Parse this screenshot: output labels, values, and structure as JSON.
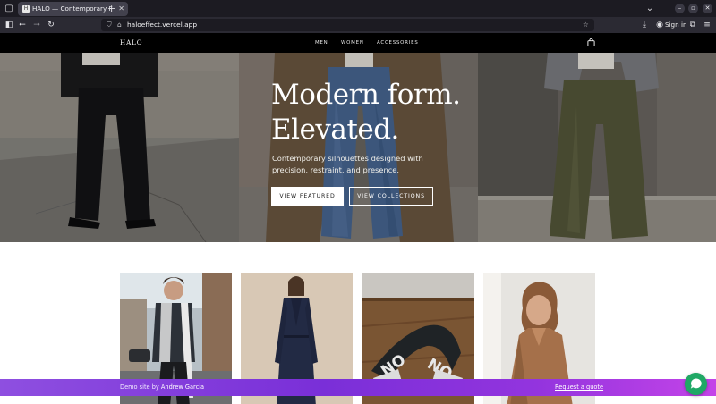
{
  "browser": {
    "tab_title": "HALO — Contemporary F",
    "tab_favicon": "H",
    "url": "haloeffect.vercel.app",
    "sign_in": "Sign in"
  },
  "site": {
    "logo": "HALO",
    "menu": [
      "MEN",
      "WOMEN",
      "ACCESSORIES"
    ],
    "cart_icon": "shopping-bag-icon"
  },
  "hero": {
    "title_line1": "Modern form.",
    "title_line2": "Elevated.",
    "subtitle": "Contemporary silhouettes designed with precision, restraint, and presence.",
    "primary_button": "VIEW FEATURED",
    "secondary_button": "VIEW COLLECTIONS"
  },
  "products": [
    {
      "image": "man-street-style-scarf"
    },
    {
      "image": "woman-navy-trench-coat"
    },
    {
      "image": "knit-scarf-on-wood"
    },
    {
      "image": "woman-camel-coat"
    }
  ],
  "demo_bar": {
    "text": "Demo site by ",
    "author": "Andrew Garcia",
    "link": "Request a quote"
  },
  "colors": {
    "accent_gradient_start": "#8e4fe0",
    "accent_gradient_end": "#c444e8",
    "chat_button": "#1fa865"
  }
}
